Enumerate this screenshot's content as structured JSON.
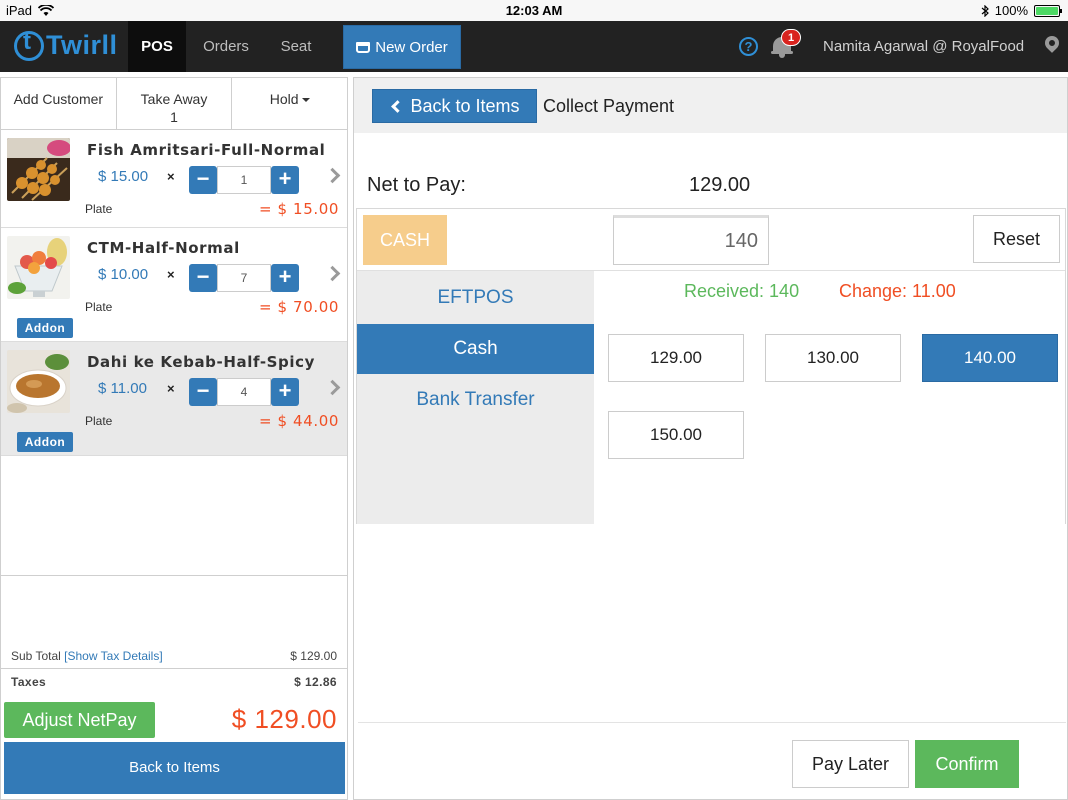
{
  "status_bar": {
    "device": "iPad",
    "time": "12:03 AM",
    "battery": "100%"
  },
  "nav": {
    "logo": "Twirll",
    "tabs": [
      {
        "label": "POS",
        "active": true
      },
      {
        "label": "Orders",
        "active": false
      },
      {
        "label": "Seat",
        "active": false
      }
    ],
    "new_order": "New Order",
    "notification_count": "1",
    "user": "Namita Agarwal @ RoyalFood"
  },
  "left": {
    "tabs": {
      "add_customer": "Add Customer",
      "take_away": "Take Away",
      "take_away_count": "1",
      "hold": "Hold"
    },
    "items": [
      {
        "name": "Fish Amritsari-Full-Normal",
        "price": "$ 15.00",
        "qty": "1",
        "unit": "Plate",
        "total": "= $ 15.00",
        "addon": null
      },
      {
        "name": "CTM-Half-Normal",
        "price": "$ 10.00",
        "qty": "7",
        "unit": "Plate",
        "total": "= $ 70.00",
        "addon": "Addon"
      },
      {
        "name": "Dahi ke Kebab-Half-Spicy",
        "price": "$ 11.00",
        "qty": "4",
        "unit": "Plate",
        "total": "= $ 44.00",
        "addon": "Addon"
      }
    ],
    "times_symbol": "×",
    "minus": "−",
    "plus": "+",
    "subtotal_label": "Sub Total",
    "tax_link": "[Show Tax Details]",
    "subtotal_value": "$ 129.00",
    "taxes_label": "Taxes",
    "taxes_value": "$ 12.86",
    "adjust_netpay": "Adjust NetPay",
    "grand_total": "$ 129.00",
    "back_to_items": "Back to Items"
  },
  "right": {
    "back_to_items": "Back to Items",
    "title": "Collect Payment",
    "net_label": "Net to Pay:",
    "net_value": "129.00",
    "cash_tag": "CASH",
    "amount_value": "140",
    "reset": "Reset",
    "methods": [
      {
        "label": "EFTPOS",
        "active": false
      },
      {
        "label": "Cash",
        "active": true
      },
      {
        "label": "Bank Transfer",
        "active": false
      }
    ],
    "received": "Received: 140",
    "change": "Change: 11.00",
    "quick_amounts": [
      {
        "label": "129.00",
        "active": false
      },
      {
        "label": "130.00",
        "active": false
      },
      {
        "label": "140.00",
        "active": true
      },
      {
        "label": "150.00",
        "active": false
      }
    ],
    "pay_later": "Pay Later",
    "confirm": "Confirm"
  },
  "colors": {
    "primary": "#337ab7",
    "success": "#5cb85c",
    "danger": "#f04e23",
    "cash_tag": "#f6cd8c",
    "nav_bg": "#222222"
  }
}
